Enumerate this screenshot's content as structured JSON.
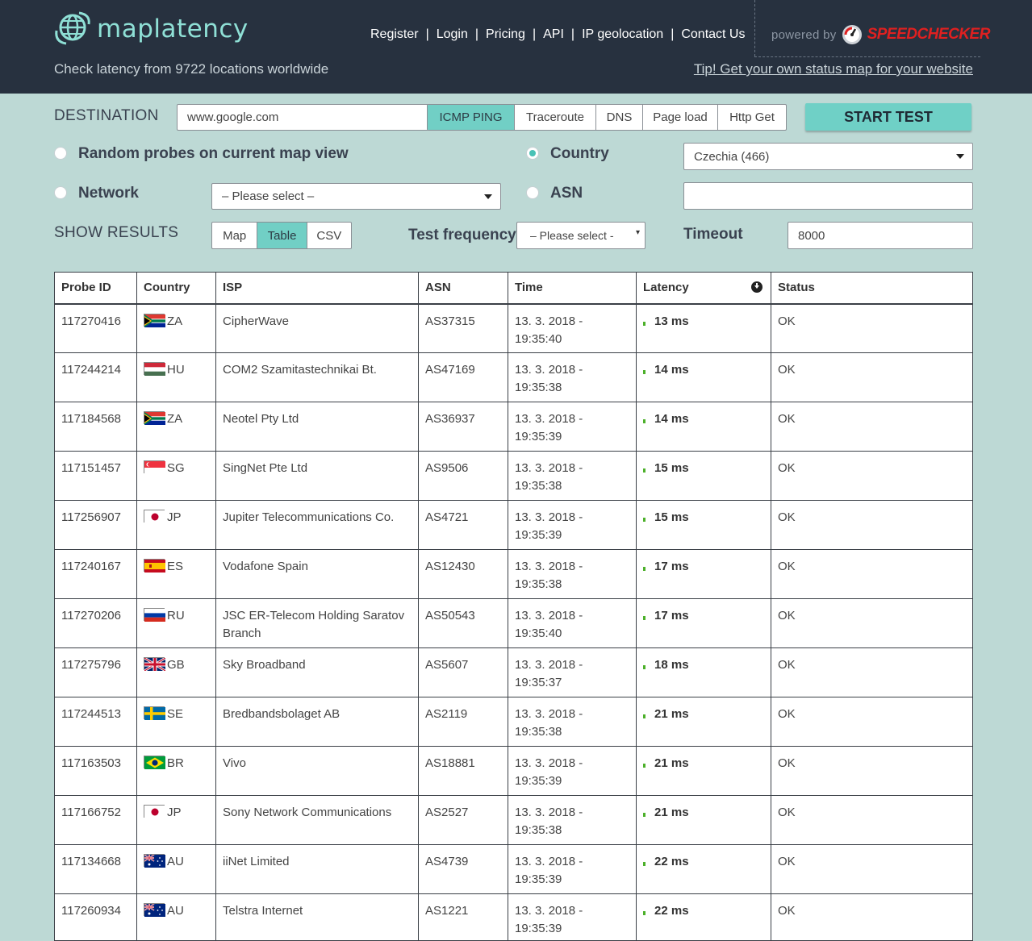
{
  "header": {
    "logo_text": "maplatency",
    "nav": [
      "Register",
      "Login",
      "Pricing",
      "API",
      "IP geolocation",
      "Contact Us"
    ],
    "powered_label": "powered by",
    "powered_brand": "SPEEDCHECKER",
    "tagline": "Check latency from 9722 locations worldwide",
    "tip": "Tip! Get your own status map for your website"
  },
  "form": {
    "destination_label": "DESTINATION",
    "destination_value": "www.google.com",
    "test_types": [
      "ICMP PING",
      "Traceroute",
      "DNS",
      "Page load",
      "Http Get"
    ],
    "active_test_type": "ICMP PING",
    "start_label": "START TEST",
    "random_label": "Random probes on current map view",
    "country_label": "Country",
    "country_value": "Czechia (466)",
    "network_label": "Network",
    "network_select": "– Please select –",
    "asn_label": "ASN",
    "asn_value": "",
    "show_results_label": "SHOW RESULTS",
    "result_modes": [
      "Map",
      "Table",
      "CSV"
    ],
    "active_result_mode": "Table",
    "frequency_label": "Test frequency",
    "frequency_select": "– Please select -",
    "timeout_label": "Timeout",
    "timeout_value": "8000"
  },
  "table": {
    "columns": [
      "Probe ID",
      "Country",
      "ISP",
      "ASN",
      "Time",
      "Latency",
      "Status"
    ],
    "rows": [
      {
        "id": "117270416",
        "cc": "ZA",
        "isp": "CipherWave",
        "asn": "AS37315",
        "date": "13. 3. 2018 -",
        "time": "19:35:40",
        "latency": "13 ms",
        "status": "OK"
      },
      {
        "id": "117244214",
        "cc": "HU",
        "isp": "COM2 Szamitastechnikai Bt.",
        "asn": "AS47169",
        "date": "13. 3. 2018 -",
        "time": "19:35:38",
        "latency": "14 ms",
        "status": "OK"
      },
      {
        "id": "117184568",
        "cc": "ZA",
        "isp": "Neotel Pty Ltd",
        "asn": "AS36937",
        "date": "13. 3. 2018 -",
        "time": "19:35:39",
        "latency": "14 ms",
        "status": "OK"
      },
      {
        "id": "117151457",
        "cc": "SG",
        "isp": "SingNet Pte Ltd",
        "asn": "AS9506",
        "date": "13. 3. 2018 -",
        "time": "19:35:38",
        "latency": "15 ms",
        "status": "OK"
      },
      {
        "id": "117256907",
        "cc": "JP",
        "isp": "Jupiter Telecommunications Co.",
        "asn": "AS4721",
        "date": "13. 3. 2018 -",
        "time": "19:35:39",
        "latency": "15 ms",
        "status": "OK"
      },
      {
        "id": "117240167",
        "cc": "ES",
        "isp": "Vodafone Spain",
        "asn": "AS12430",
        "date": "13. 3. 2018 -",
        "time": "19:35:38",
        "latency": "17 ms",
        "status": "OK"
      },
      {
        "id": "117270206",
        "cc": "RU",
        "isp": "JSC ER-Telecom Holding Saratov Branch",
        "asn": "AS50543",
        "date": "13. 3. 2018 -",
        "time": "19:35:40",
        "latency": "17 ms",
        "status": "OK"
      },
      {
        "id": "117275796",
        "cc": "GB",
        "isp": "Sky Broadband",
        "asn": "AS5607",
        "date": "13. 3. 2018 -",
        "time": "19:35:37",
        "latency": "18 ms",
        "status": "OK"
      },
      {
        "id": "117244513",
        "cc": "SE",
        "isp": "Bredbandsbolaget AB",
        "asn": "AS2119",
        "date": "13. 3. 2018 -",
        "time": "19:35:38",
        "latency": "21 ms",
        "status": "OK"
      },
      {
        "id": "117163503",
        "cc": "BR",
        "isp": "Vivo",
        "asn": "AS18881",
        "date": "13. 3. 2018 -",
        "time": "19:35:39",
        "latency": "21 ms",
        "status": "OK"
      },
      {
        "id": "117166752",
        "cc": "JP",
        "isp": "Sony Network Communications",
        "asn": "AS2527",
        "date": "13. 3. 2018 -",
        "time": "19:35:38",
        "latency": "21 ms",
        "status": "OK"
      },
      {
        "id": "117134668",
        "cc": "AU",
        "isp": "iiNet Limited",
        "asn": "AS4739",
        "date": "13. 3. 2018 -",
        "time": "19:35:39",
        "latency": "22 ms",
        "status": "OK"
      },
      {
        "id": "117260934",
        "cc": "AU",
        "isp": "Telstra Internet",
        "asn": "AS1221",
        "date": "13. 3. 2018 -",
        "time": "19:35:39",
        "latency": "22 ms",
        "status": "OK"
      }
    ]
  },
  "colors": {
    "header_bg": "#27313f",
    "page_bg": "#bdd9d5",
    "accent": "#71cfc5",
    "brand_red": "#e02020",
    "latency_bar": "#4cb02a"
  },
  "icons": {
    "logo": "globe-icon",
    "powered": "speedometer-icon",
    "sort": "sort-down-icon"
  }
}
